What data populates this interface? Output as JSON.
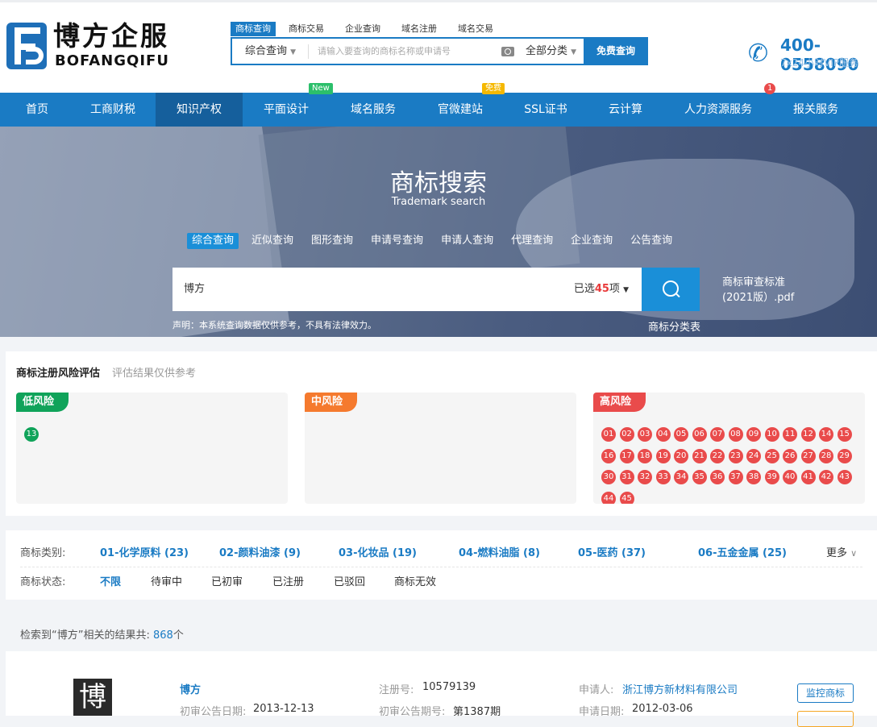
{
  "brand": {
    "name_cn": "博方企服",
    "name_en": "BOFANGQIFU"
  },
  "search_tabs": [
    "商标查询",
    "商标交易",
    "企业查询",
    "域名注册",
    "域名交易"
  ],
  "search": {
    "type": "综合查询",
    "placeholder": "请输入要查询的商标名称或申请号",
    "category": "全部分类",
    "button": "免费查询"
  },
  "contact": {
    "phone": "400-0558090",
    "sub": "7x24小时VIP服务"
  },
  "nav": [
    {
      "label": "首页"
    },
    {
      "label": "工商财税"
    },
    {
      "label": "知识产权",
      "active": true
    },
    {
      "label": "平面设计",
      "badge": "New"
    },
    {
      "label": "域名服务"
    },
    {
      "label": "官微建站",
      "badge": "免费"
    },
    {
      "label": "SSL证书"
    },
    {
      "label": "云计算"
    },
    {
      "label": "人力资源服务",
      "badge": "1"
    },
    {
      "label": "报关服务"
    }
  ],
  "banner": {
    "title": "商标搜索",
    "subtitle": "Trademark search",
    "tabs": [
      "综合查询",
      "近似查询",
      "图形查询",
      "申请号查询",
      "申请人查询",
      "代理查询",
      "企业查询",
      "公告查询"
    ],
    "query": "博方",
    "selected_prefix": "已选",
    "selected_count": "45",
    "selected_suffix": "项",
    "note": "声明：本系统查询数据仅供参考，不具有法律效力。",
    "pdf_line1": "商标审查标准",
    "pdf_line2": "(2021版）.pdf",
    "classes": "商标分类表"
  },
  "risk": {
    "title": "商标注册风险评估",
    "subtitle": "评估结果仅供参考",
    "low": {
      "label": "低风险",
      "classes": [
        "13"
      ]
    },
    "mid": {
      "label": "中风险",
      "classes": []
    },
    "high": {
      "label": "高风险",
      "classes": [
        "01",
        "02",
        "03",
        "04",
        "05",
        "06",
        "07",
        "08",
        "09",
        "10",
        "11",
        "12",
        "14",
        "15",
        "16",
        "17",
        "18",
        "19",
        "20",
        "21",
        "22",
        "23",
        "24",
        "25",
        "26",
        "27",
        "28",
        "29",
        "30",
        "31",
        "32",
        "33",
        "34",
        "35",
        "36",
        "37",
        "38",
        "39",
        "40",
        "41",
        "42",
        "43",
        "44",
        "45"
      ]
    }
  },
  "filter": {
    "category_label": "商标类别:",
    "categories": [
      "01-化学原料 (23)",
      "02-颜料油漆 (9)",
      "03-化妆品 (19)",
      "04-燃料油脂 (8)",
      "05-医药 (37)",
      "06-五金金属 (25)"
    ],
    "more": "更多",
    "status_label": "商标状态:",
    "statuses": [
      "不限",
      "待审中",
      "已初审",
      "已注册",
      "已驳回",
      "商标无效"
    ]
  },
  "results": {
    "prefix": "检索到“博方”相关的结果共:",
    "count": "868",
    "suffix": "个",
    "item": {
      "logo_char": "博",
      "name": "博方",
      "pub_date_label": "初审公告日期:",
      "pub_date": "2013-12-13",
      "reg_no_label": "注册号:",
      "reg_no": "10579139",
      "pub_issue_label": "初审公告期号:",
      "pub_issue": "第1387期",
      "applicant_label": "申请人:",
      "applicant": "浙江博方新材料有限公司",
      "apply_date_label": "申请日期:",
      "apply_date": "2012-03-06",
      "monitor_button": "监控商标"
    }
  },
  "colors": {
    "primary": "#1a7bc4",
    "low": "#10a35a",
    "mid": "#f57a2e",
    "high": "#e94b4b"
  }
}
